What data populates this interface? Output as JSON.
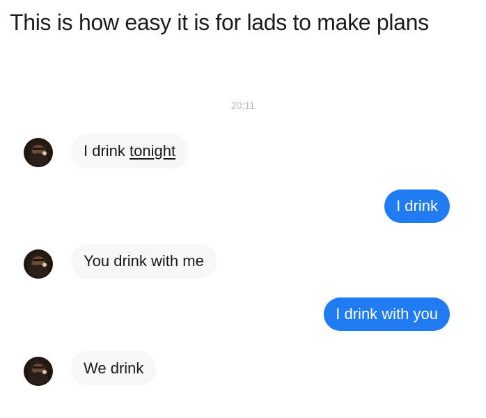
{
  "caption": "This is how easy it is for lads to make plans",
  "timestamp": "20:11",
  "messages": [
    {
      "from": "them",
      "text_plain": "I drink ",
      "text_link": "tonight"
    },
    {
      "from": "me",
      "text": "I drink"
    },
    {
      "from": "them",
      "text": "You drink with me"
    },
    {
      "from": "me",
      "text": "I drink with you"
    },
    {
      "from": "them",
      "text": "We drink"
    }
  ],
  "colors": {
    "outgoing_bubble": "#1f7cf2",
    "incoming_bubble": "#f7f7f7",
    "timestamp": "#b9b9b9"
  },
  "icons": {
    "avatar": "contact-avatar"
  }
}
